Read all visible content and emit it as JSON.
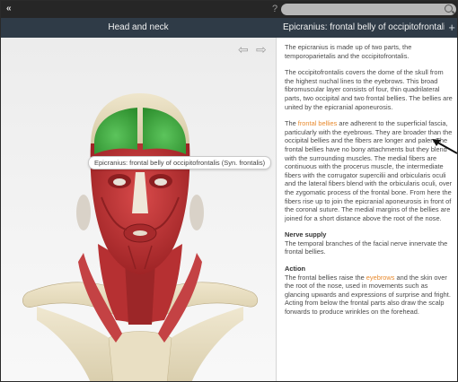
{
  "topbar": {
    "close_label": "«",
    "help_label": "?",
    "search": {
      "placeholder": ""
    }
  },
  "titlebar": {
    "left_title": "Head and neck",
    "right_title": "Epicranius: frontal belly of occipitofrontalis (...",
    "add_label": "+"
  },
  "viewport": {
    "back_arrow": "⇦",
    "forward_arrow": "⇨",
    "tooltip": "Epicranius: frontal belly of occipitofrontalis (Syn. frontalis)",
    "highlight_color": "#3cae3c",
    "muscle_color": "#c8383a",
    "bone_color": "#e6dcc0"
  },
  "panel": {
    "p1": "The epicranius is made up of two parts, the temporoparietalis and the occipitofrontalis.",
    "p2": "The occipitofrontalis covers the dome of the skull from the highest nuchal lines to the eyebrows. This broad fibromuscular layer consists of four, thin quadrilateral parts, two occipital and two frontal bellies. The bellies are united by the epicranial aponeurosis.",
    "p3_pre": "The ",
    "p3_link": "frontal bellies",
    "p3_post": " are adherent to the superficial fascia, particularly with the eyebrows. They are broader than the occipital bellies and the fibers are longer and paler. The frontal bellies have no bony attachments but they blend with the surrounding muscles. The medial fibers are continuous with the procerus muscle, the intermediate fibers with the corrugator supercilii and orbicularis oculi and the lateral fibers blend with the orbicularis oculi, over the zygomatic process of the frontal bone. From here the fibers rise up to join the epicranial aponeurosis in front of the coronal suture. The medial margins of the bellies are joined for a short distance above the root of the nose.",
    "nerve_title": "Nerve supply",
    "nerve_text": "The temporal branches of the facial nerve innervate the frontal bellies.",
    "action_title": "Action",
    "action_pre": "The frontal bellies raise the ",
    "action_link": "eyebrows",
    "action_post": " and the skin over the root of the nose, used in movements such as glancing upwards and expressions of surprise and fright. Acting from below the frontal parts also draw the scalp forwards to produce wrinkles on the forehead.",
    "link_color": "#e88a2e"
  }
}
